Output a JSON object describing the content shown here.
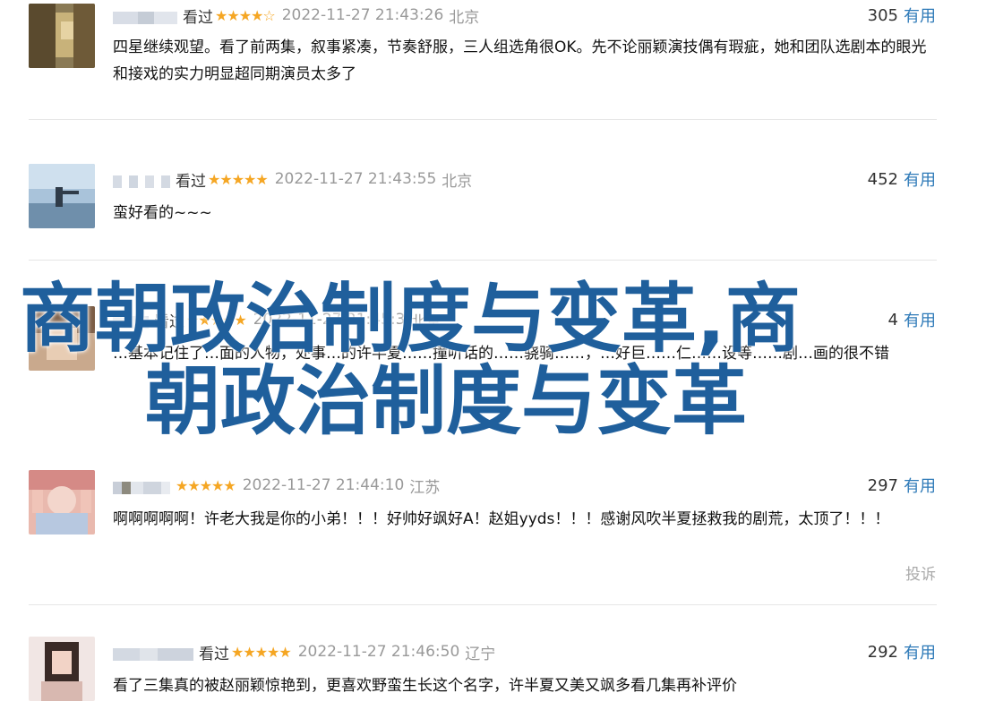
{
  "reviews": [
    {
      "watched": "看过",
      "stars": "★★★★☆",
      "time": "2022-11-27 21:43:26",
      "location": "北京",
      "votes": "305",
      "useful": "有用",
      "content": "四星继续观望。看了前两集，叙事紧凑，节奏舒服，三人组选角很OK。先不论丽颖演技偶有瑕疵，她和团队选剧本的眼光和接戏的实力明显超同期演员太多了"
    },
    {
      "watched": "看过",
      "stars": "★★★★★",
      "time": "2022-11-27 21:43:55",
      "location": "北京",
      "votes": "452",
      "useful": "有用",
      "content": "蛮好看的~~~"
    },
    {
      "watched": "看过",
      "stars": "★★★★★",
      "time": "2022-11-27 21:45:3",
      "location": "北京",
      "votes": "4",
      "useful": "有用",
      "content": "…基本记住了…面的人物，处事…的许半夏……撞听话的……骁骑……，…好巨……仁……设等……剧…画的很不错"
    },
    {
      "watched": "",
      "stars": "★★★★★",
      "time": "2022-11-27 21:44:10",
      "location": "江苏",
      "votes": "297",
      "useful": "有用",
      "content": "啊啊啊啊啊！许老大我是你的小弟！！！好帅好飒好A！赵姐yyds！！！感谢风吹半夏拯救我的剧荒，太顶了！！！",
      "report": "投诉"
    },
    {
      "watched": "看过",
      "stars": "★★★★★",
      "time": "2022-11-27 21:46:50",
      "location": "辽宁",
      "votes": "292",
      "useful": "有用",
      "content": "看了三集真的被赵丽颖惊艳到，更喜欢野蛮生长这个名字，许半夏又美又飒多看几集再补评价"
    }
  ],
  "overlay": {
    "line1": "商朝政治制度与变革,商",
    "line2": "朝政治制度与变革"
  },
  "colors": {
    "link": "#2e7ab8",
    "star": "#f5a623",
    "muted": "#999999",
    "overlay": "#1f5f9c",
    "divider": "#e6e6e6"
  }
}
